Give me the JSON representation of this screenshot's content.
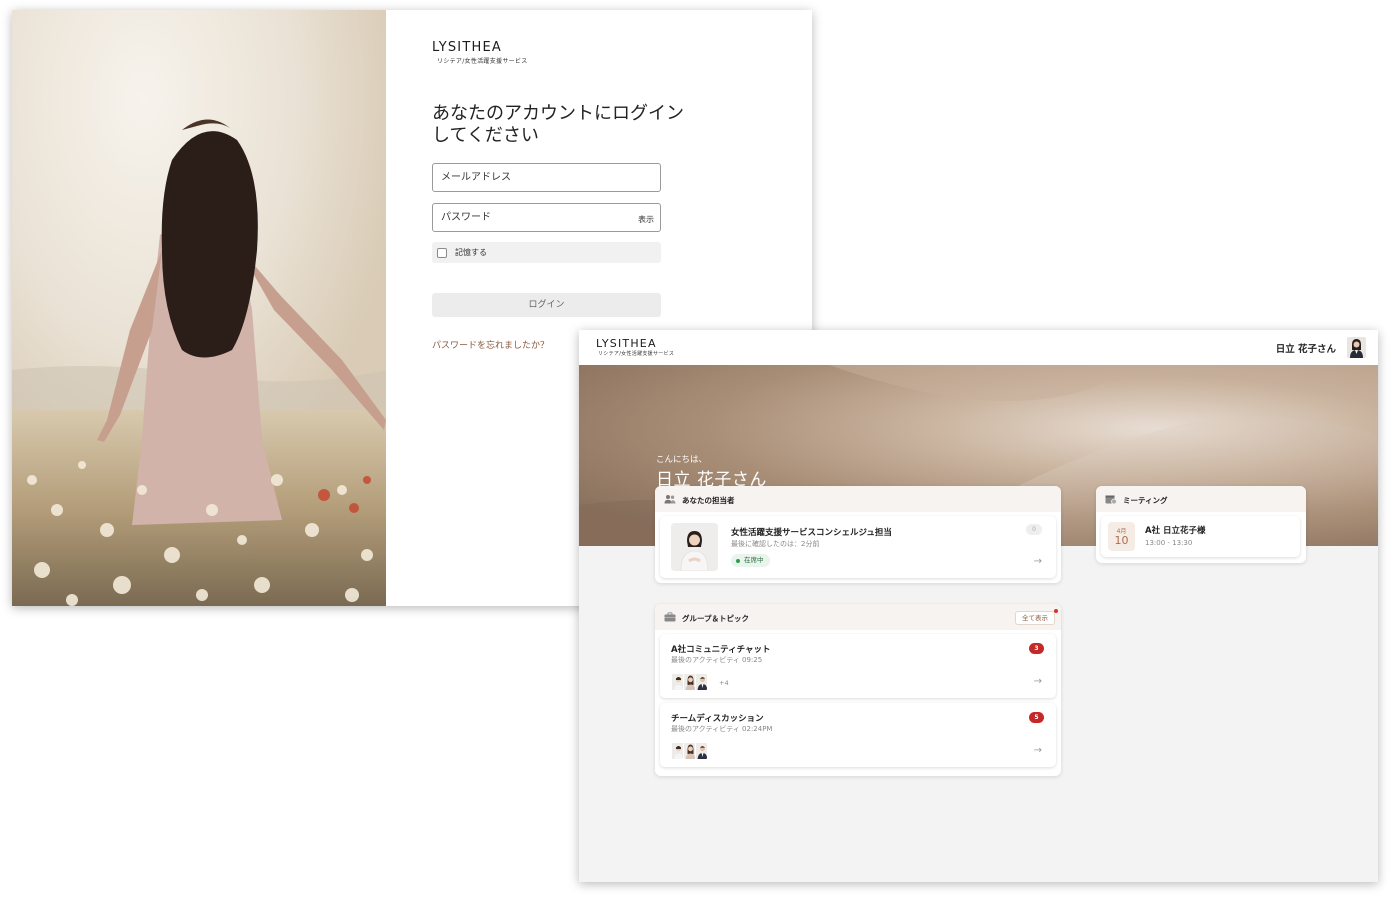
{
  "login": {
    "logo": {
      "word": "LYSITHEA",
      "subtitle": "リシテア/女性活躍支援サービス"
    },
    "title_line1": "あなたのアカウントにログイン",
    "title_line2": "してください",
    "email_placeholder": "メールアドレス",
    "password_placeholder": "パスワード",
    "show_password_label": "表示",
    "remember_label": "記憶する",
    "remember_checked": false,
    "login_button_label": "ログイン",
    "forgot_password_link": "パスワードを忘れましたか？"
  },
  "dashboard": {
    "logo": {
      "word": "LYSITHEA",
      "subtitle": "リシテア/女性活躍支援サービス"
    },
    "user_name": "日立 花子さん",
    "greeting_small": "こんにちは、",
    "greeting_name": "日立 花子さん",
    "concierge_card": {
      "title": "あなたの担当者",
      "name": "女性活躍支援サービスコンシェルジュ担当",
      "last_seen": "最後に確認したのは：2分前",
      "status": "在席中",
      "unread_count": "0"
    },
    "meeting_card": {
      "title": "ミーティング",
      "month": "4月",
      "day": "10",
      "meeting_title": "A社 日立花子様",
      "time": "13:00 - 13:30"
    },
    "groups_card": {
      "title": "グループ＆トピック",
      "view_all_label": "全て表示",
      "items": [
        {
          "name": "A社コミュニティチャット",
          "activity": "最後のアクティビティ 09:25",
          "unread": "3",
          "more_members": "+4"
        },
        {
          "name": "チームディスカッション",
          "activity": "最後のアクティビティ 02:24PM",
          "unread": "5",
          "more_members": ""
        }
      ]
    }
  },
  "colors": {
    "accent_brown": "#8a5a3e",
    "badge_red": "#c62828",
    "status_green": "#2e9c4d",
    "panel_bg": "#f3f3f3"
  },
  "icons": {
    "concierge_head": "people-icon",
    "meeting_head": "calendar-icon",
    "groups_head": "briefcase-icon",
    "item_arrow": "arrow-right-icon"
  }
}
